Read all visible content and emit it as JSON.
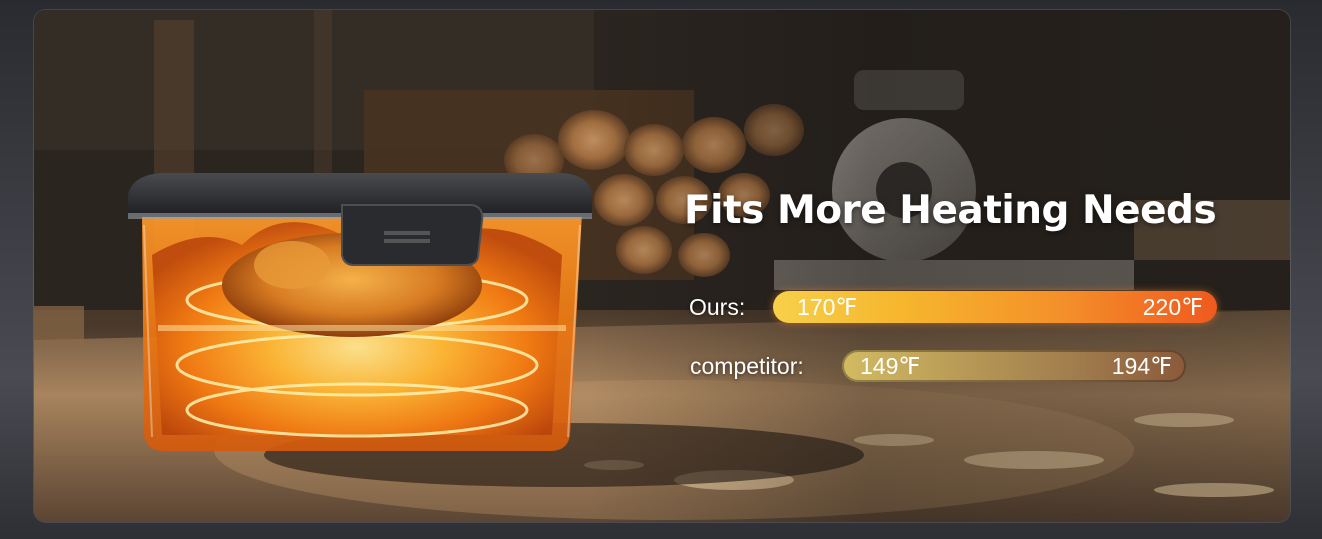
{
  "headline": "Fits More Heating Needs",
  "comparison": {
    "ours": {
      "label": "Ours:",
      "min": "170℉",
      "max": "220℉",
      "color_start": "#f7d04a",
      "color_end": "#ef5a1e"
    },
    "competitor": {
      "label": "competitor:",
      "min": "149℉",
      "max": "194℉",
      "color_start": "#d2bb62",
      "color_end": "#8a5a3a"
    }
  },
  "colors": {
    "headline": "#ffffff",
    "flame": "#f59a22",
    "lid": "#2b2c2f"
  }
}
